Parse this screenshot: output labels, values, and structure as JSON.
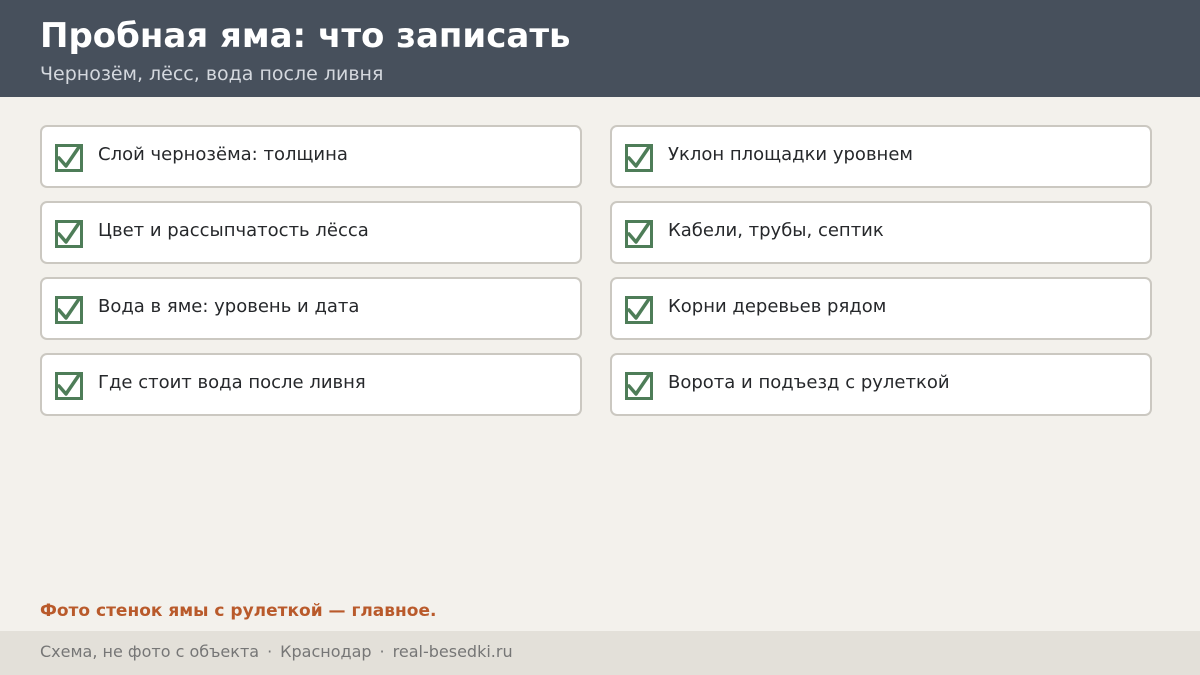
{
  "header": {
    "title": "Пробная яма: что записать",
    "subtitle": "Чернозём, лёсс, вода после ливня"
  },
  "checklist": {
    "left": [
      {
        "label": "Слой чернозёма: толщина",
        "checked": true
      },
      {
        "label": "Цвет и рассыпчатость лёсса",
        "checked": true
      },
      {
        "label": "Вода в яме: уровень и дата",
        "checked": true
      },
      {
        "label": "Где стоит вода после ливня",
        "checked": true
      }
    ],
    "right": [
      {
        "label": "Уклон площадки уровнем",
        "checked": true
      },
      {
        "label": "Кабели, трубы, септик",
        "checked": true
      },
      {
        "label": "Корни деревьев рядом",
        "checked": true
      },
      {
        "label": "Ворота и подъезд с рулеткой",
        "checked": true
      }
    ],
    "check_icon": "checkbox-checked-icon"
  },
  "note": "Фото стенок ямы с рулеткой — главное.",
  "footer": {
    "parts": [
      "Схема, не фото с объекта",
      "Краснодар",
      "real-besedki.ru"
    ],
    "separator": "·"
  },
  "colors": {
    "header_bg": "#47505c",
    "page_bg": "#f3f1ec",
    "check_green": "#4e7d58",
    "note_accent": "#b95a2b",
    "footer_bg": "#e3e0d9"
  }
}
